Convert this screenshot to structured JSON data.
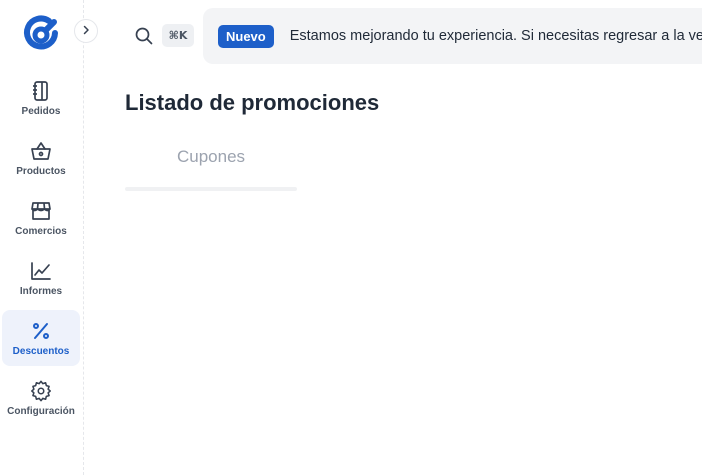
{
  "sidebar": {
    "logo": "app-logo",
    "collapse_icon": "chevron-right-icon",
    "items": [
      {
        "label": "Pedidos",
        "icon": "notebook-icon",
        "active": false
      },
      {
        "label": "Productos",
        "icon": "basket-icon",
        "active": false
      },
      {
        "label": "Comercios",
        "icon": "store-icon",
        "active": false
      },
      {
        "label": "Informes",
        "icon": "line-chart-icon",
        "active": false
      },
      {
        "label": "Descuentos",
        "icon": "percent-icon",
        "active": true
      },
      {
        "label": "Configuración",
        "icon": "gear-icon",
        "active": false
      }
    ]
  },
  "topbar": {
    "search_icon": "search-icon",
    "shortcut": "⌘K",
    "banner": {
      "badge": "Nuevo",
      "text": "Estamos mejorando tu experiencia. Si necesitas regresar a la ver"
    }
  },
  "main": {
    "title": "Listado de promociones",
    "tabs": [
      {
        "label": "Cupones"
      }
    ]
  },
  "colors": {
    "accent": "#1d5fc9",
    "active_bg": "#eef2fb",
    "banner_bg": "#f3f4f6",
    "muted_text": "#9ca3af"
  }
}
